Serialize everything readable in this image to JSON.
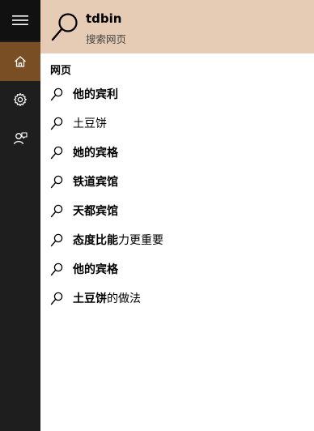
{
  "top_result": {
    "title": "tdbin",
    "subtitle": "搜索网页"
  },
  "section_header": "网页",
  "suggestions": [
    {
      "bold": "他的宾利",
      "rest": ""
    },
    {
      "bold": "",
      "rest": "土豆饼"
    },
    {
      "bold": "她的宾格",
      "rest": ""
    },
    {
      "bold": "铁道宾馆",
      "rest": ""
    },
    {
      "bold": "天都宾馆",
      "rest": ""
    },
    {
      "bold": "态度比能",
      "rest": "力更重要"
    },
    {
      "bold": "他的宾格",
      "rest": ""
    },
    {
      "bold": "土豆饼",
      "rest": "的做法"
    }
  ],
  "rail": {
    "items": [
      "hamburger-menu-icon",
      "home-icon",
      "settings-gear-icon",
      "feedback-icon"
    ],
    "accent_color": "#7a4e24"
  },
  "colors": {
    "top_result_bg": "#e6cbb5",
    "rail_bg": "#1e1e1e"
  }
}
